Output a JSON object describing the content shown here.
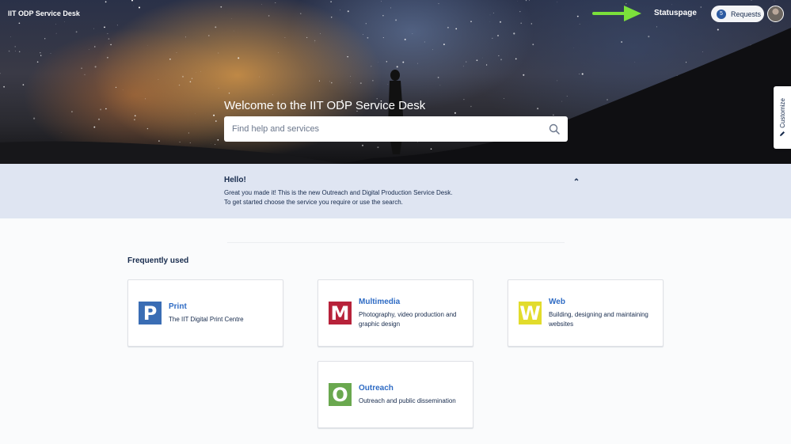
{
  "header": {
    "app_title": "IIT ODP Service Desk",
    "statuspage_label": "Statuspage",
    "requests_count": "5",
    "requests_label": "Requests"
  },
  "hero": {
    "welcome": "Welcome to the IIT ODP Service Desk",
    "search_placeholder": "Find help and services",
    "customize_label": "Customize"
  },
  "announcement": {
    "title": "Hello!",
    "line1": "Great you made it! This is the new Outreach and Digital Production Service Desk.",
    "line2": "To get started choose the service you require or use the search."
  },
  "services": {
    "section_title": "Frequently used",
    "items": [
      {
        "letter": "P",
        "title": "Print",
        "desc": "The IIT Digital Print Centre",
        "color": "#3a6db4"
      },
      {
        "letter": "M",
        "title": "Multimedia",
        "desc": "Photography, video production and graphic design",
        "color": "#b7223a"
      },
      {
        "letter": "W",
        "title": "Web",
        "desc": "Building, designing and maintaining websites",
        "color": "#e2dc2c"
      },
      {
        "letter": "O",
        "title": "Outreach",
        "desc": "Outreach and public dissemination",
        "color": "#6aa84f"
      }
    ]
  },
  "colors": {
    "link": "#2e6bc4",
    "annotation_arrow": "#7be03b"
  }
}
